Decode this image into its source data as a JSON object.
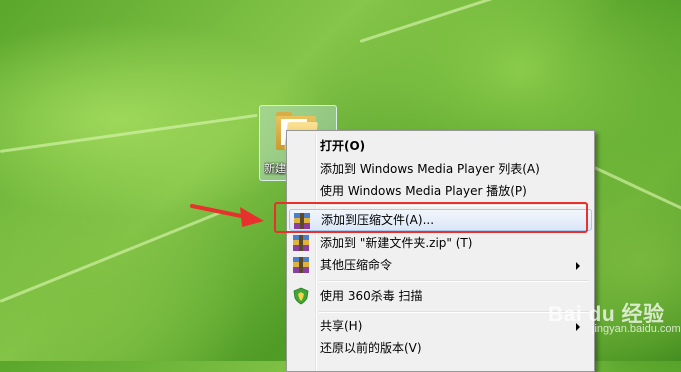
{
  "desktop": {
    "folder_label": "新建"
  },
  "context_menu": {
    "items": [
      {
        "label": "打开(O)"
      },
      {
        "label": "添加到 Windows Media Player 列表(A)"
      },
      {
        "label": "使用 Windows Media Player 播放(P)"
      },
      {
        "label": "添加到压缩文件(A)..."
      },
      {
        "label": "添加到 \"新建文件夹.zip\" (T)"
      },
      {
        "label": "其他压缩命令"
      },
      {
        "label": "使用 360杀毒 扫描"
      },
      {
        "label": "共享(H)"
      },
      {
        "label": "还原以前的版本(V)"
      }
    ]
  },
  "watermark": {
    "brand": "Bai du 经验",
    "sub": "jingyan.baidu.com"
  },
  "colors": {
    "highlight_box": "#e8312c",
    "arrow": "#e8312c",
    "menu_bg": "#f0f0f0"
  }
}
